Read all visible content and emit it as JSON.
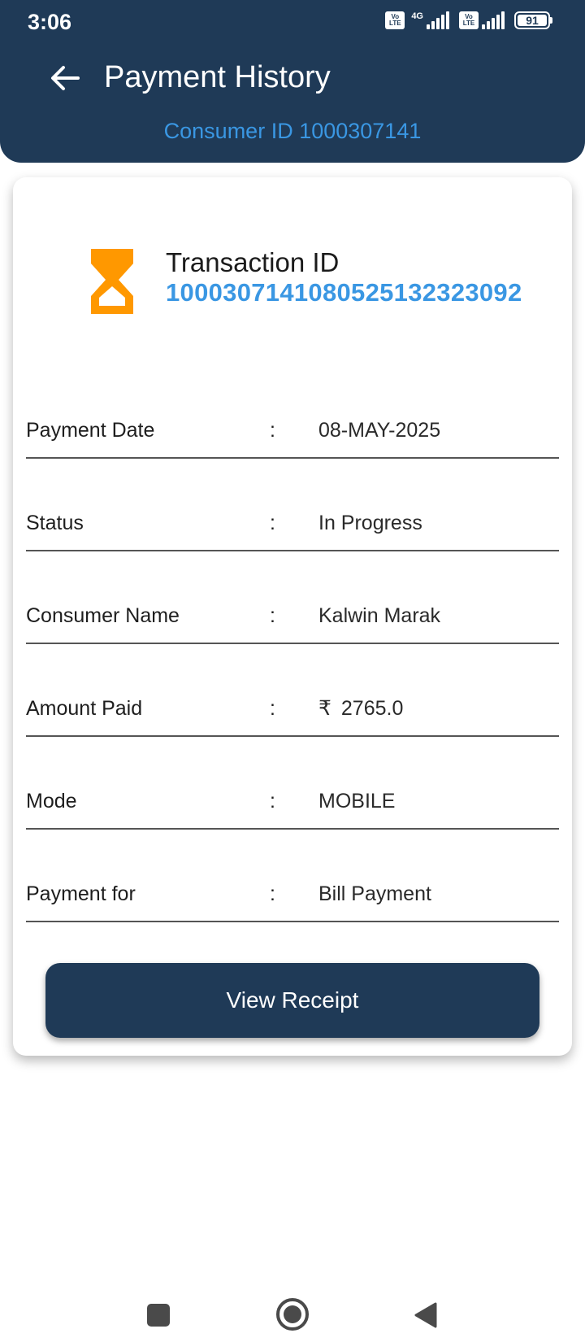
{
  "status_bar": {
    "time": "3:06",
    "volte1": [
      "Vo",
      "LTE"
    ],
    "network": "4G",
    "volte2": [
      "Vo",
      "LTE"
    ],
    "battery": "91"
  },
  "header": {
    "title": "Payment History",
    "consumer_id": "Consumer ID 1000307141",
    "back_icon": "arrow-left-icon"
  },
  "transaction": {
    "label": "Transaction ID",
    "id": "10003071410805251323230​92",
    "icon": "hourglass-icon",
    "icon_color": "#ff9800"
  },
  "rows": [
    {
      "label": "Payment Date",
      "colon": ":",
      "value": "08-MAY-2025"
    },
    {
      "label": "Status",
      "colon": ":",
      "value": "In Progress"
    },
    {
      "label": "Consumer Name",
      "colon": ":",
      "value": "Kalwin Marak"
    },
    {
      "label": "Amount Paid",
      "colon": ":",
      "currency": "₹",
      "value": "2765.0"
    },
    {
      "label": "Mode",
      "colon": ":",
      "value": "MOBILE"
    },
    {
      "label": "Payment for",
      "colon": ":",
      "value": "Bill Payment"
    }
  ],
  "actions": {
    "view_receipt": "View Receipt"
  },
  "colors": {
    "primary": "#1f3a57",
    "accent": "#3a97e3"
  }
}
